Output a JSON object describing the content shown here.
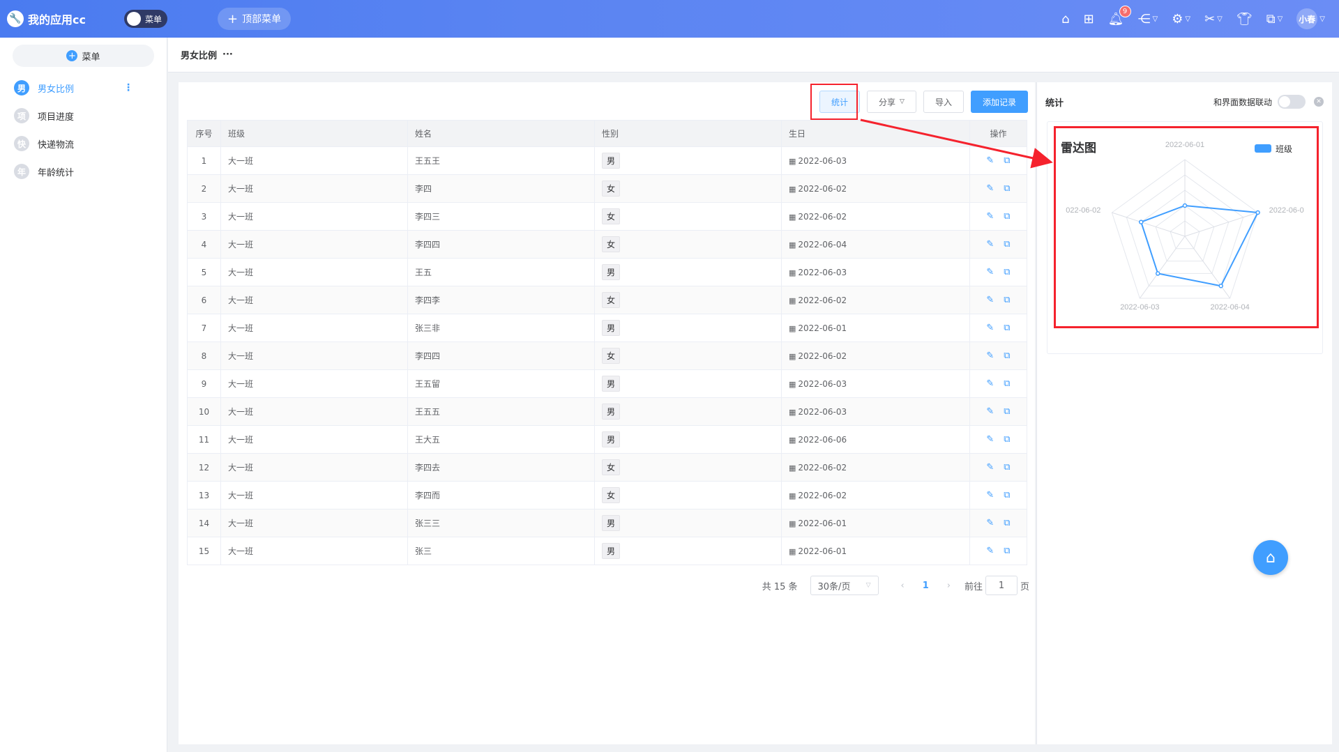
{
  "app": {
    "title": "我的应用cc",
    "menu_toggle_label": "菜单",
    "top_menu_label": "顶部菜单"
  },
  "topbar": {
    "notification_count": "9",
    "user_name": "小春"
  },
  "sidebar": {
    "menu_button": "菜单",
    "items": [
      {
        "icon_char": "男",
        "label": "男女比例",
        "active": true
      },
      {
        "icon_char": "项",
        "label": "项目进度"
      },
      {
        "icon_char": "快",
        "label": "快递物流"
      },
      {
        "icon_char": "年",
        "label": "年龄统计"
      }
    ]
  },
  "page": {
    "title": "男女比例",
    "more": "···"
  },
  "toolbar": {
    "stat_label": "统计",
    "share_label": "分享",
    "import_label": "导入",
    "add_label": "添加记录"
  },
  "table": {
    "headers": [
      "序号",
      "班级",
      "姓名",
      "性别",
      "生日",
      "操作"
    ],
    "rows": [
      [
        "1",
        "大一班",
        "王五王",
        "男",
        "2022-06-03"
      ],
      [
        "2",
        "大一班",
        "李四",
        "女",
        "2022-06-02"
      ],
      [
        "3",
        "大一班",
        "李四三",
        "女",
        "2022-06-02"
      ],
      [
        "4",
        "大一班",
        "李四四",
        "女",
        "2022-06-04"
      ],
      [
        "5",
        "大一班",
        "王五",
        "男",
        "2022-06-03"
      ],
      [
        "6",
        "大一班",
        "李四李",
        "女",
        "2022-06-02"
      ],
      [
        "7",
        "大一班",
        "张三非",
        "男",
        "2022-06-01"
      ],
      [
        "8",
        "大一班",
        "李四四",
        "女",
        "2022-06-02"
      ],
      [
        "9",
        "大一班",
        "王五留",
        "男",
        "2022-06-03"
      ],
      [
        "10",
        "大一班",
        "王五五",
        "男",
        "2022-06-03"
      ],
      [
        "11",
        "大一班",
        "王大五",
        "男",
        "2022-06-06"
      ],
      [
        "12",
        "大一班",
        "李四去",
        "女",
        "2022-06-02"
      ],
      [
        "13",
        "大一班",
        "李四而",
        "女",
        "2022-06-02"
      ],
      [
        "14",
        "大一班",
        "张三三",
        "男",
        "2022-06-01"
      ],
      [
        "15",
        "大一班",
        "张三",
        "男",
        "2022-06-01"
      ]
    ]
  },
  "pager": {
    "total": "共 15 条",
    "page_size": "30条/页",
    "current": "1",
    "goto_prefix": "前往",
    "goto_value": "1",
    "goto_suffix": "页"
  },
  "stat_panel": {
    "title": "统计",
    "link_label": "和界面数据联动"
  },
  "chart_data": {
    "type": "radar",
    "title": "雷达图",
    "indicators": [
      "2022-06-01",
      "2022-06-0",
      "2022-06-04",
      "2022-06-03",
      "022-06-02"
    ],
    "series": [
      {
        "name": "班级",
        "values": [
          2,
          5,
          4,
          3,
          3
        ]
      }
    ],
    "max": 5,
    "color": "#409eff"
  },
  "colors": {
    "accent": "#409eff",
    "highlight": "#f5222d"
  }
}
